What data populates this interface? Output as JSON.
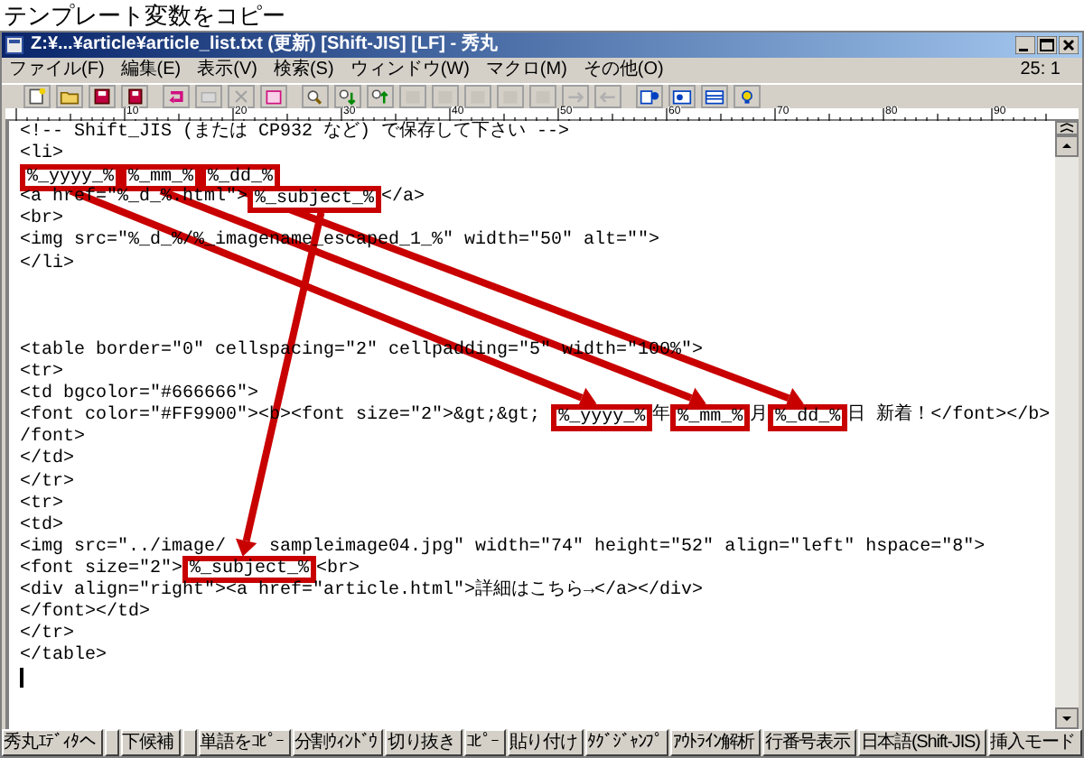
{
  "caption": "テンプレート変数をコピー",
  "window": {
    "title": "Z:¥...¥article¥article_list.txt (更新) [Shift-JIS] [LF] - 秀丸"
  },
  "menu": [
    "ファイル(F)",
    "編集(E)",
    "表示(V)",
    "検索(S)",
    "ウィンドウ(W)",
    "マクロ(M)",
    "その他(O)"
  ],
  "cursor_position": "25: 1",
  "ruler_labels": [
    "10",
    "20",
    "30",
    "40",
    "50",
    "60",
    "70",
    "80",
    "90"
  ],
  "editor": {
    "lines": [
      {
        "kind": "code",
        "segments": [
          {
            "kind": "text",
            "text": "<!-- Shift_JIS (または CP932 など) で保存して下さい -->"
          }
        ]
      },
      {
        "kind": "code",
        "segments": [
          {
            "kind": "text",
            "text": "<li>"
          }
        ]
      },
      {
        "kind": "code",
        "segments": [
          {
            "kind": "variable",
            "text": "%_yyyy_%"
          },
          {
            "kind": "variable",
            "text": "%_mm_%"
          },
          {
            "kind": "variable",
            "text": "%_dd_%"
          }
        ]
      },
      {
        "kind": "code",
        "segments": [
          {
            "kind": "text",
            "text": "<a href=\"%_d_%.html\">"
          },
          {
            "kind": "variable",
            "text": "%_subject_%"
          },
          {
            "kind": "text",
            "text": "</a>"
          }
        ]
      },
      {
        "kind": "code",
        "segments": [
          {
            "kind": "text",
            "text": "<br>"
          }
        ]
      },
      {
        "kind": "code",
        "segments": [
          {
            "kind": "text",
            "text": "<img src=\"%_d_%/%_imagename_escaped_1_%\" width=\"50\" alt=\"\">"
          }
        ]
      },
      {
        "kind": "code",
        "segments": [
          {
            "kind": "text",
            "text": "</li>"
          }
        ]
      },
      {
        "kind": "blank"
      },
      {
        "kind": "blank"
      },
      {
        "kind": "blank"
      },
      {
        "kind": "code",
        "segments": [
          {
            "kind": "text",
            "text": "<table border=\"0\" cellspacing=\"2\" cellpadding=\"5\" width=\"100%\">"
          }
        ]
      },
      {
        "kind": "code",
        "segments": [
          {
            "kind": "text",
            "text": "<tr>"
          }
        ]
      },
      {
        "kind": "code",
        "segments": [
          {
            "kind": "text",
            "text": "<td bgcolor=\"#666666\">"
          }
        ]
      },
      {
        "kind": "code",
        "segments": [
          {
            "kind": "text",
            "text": "<font color=\"#FF9900\"><b><font size=\"2\">&gt;&gt; "
          },
          {
            "kind": "variable",
            "text": "%_yyyy_%"
          },
          {
            "kind": "text",
            "text": "年"
          },
          {
            "kind": "variable",
            "text": "%_mm_%"
          },
          {
            "kind": "text",
            "text": "月"
          },
          {
            "kind": "variable",
            "text": "%_dd_%"
          },
          {
            "kind": "text",
            "text": "日 新着！</font></b>"
          }
        ]
      },
      {
        "kind": "code",
        "segments": [
          {
            "kind": "text",
            "text": "/font>"
          }
        ]
      },
      {
        "kind": "code",
        "segments": [
          {
            "kind": "text",
            "text": "</td>"
          }
        ]
      },
      {
        "kind": "code",
        "segments": [
          {
            "kind": "text",
            "text": "</tr>"
          }
        ]
      },
      {
        "kind": "code",
        "segments": [
          {
            "kind": "text",
            "text": "<tr>"
          }
        ]
      },
      {
        "kind": "code",
        "segments": [
          {
            "kind": "text",
            "text": "<td>"
          }
        ]
      },
      {
        "kind": "code",
        "segments": [
          {
            "kind": "text",
            "text": "<img src=\"../image/    sampleimage04.jpg\" width=\"74\" height=\"52\" align=\"left\" hspace=\"8\">"
          }
        ]
      },
      {
        "kind": "code",
        "segments": [
          {
            "kind": "text",
            "text": "<font size=\"2\">"
          },
          {
            "kind": "variable",
            "text": "%_subject_%"
          },
          {
            "kind": "text",
            "text": "<br>"
          }
        ]
      },
      {
        "kind": "code",
        "segments": [
          {
            "kind": "text",
            "text": "<div align=\"right\"><a href=\"article.html\">詳細はこちら→</a></div>"
          }
        ]
      },
      {
        "kind": "code",
        "segments": [
          {
            "kind": "text",
            "text": "</font></td>"
          }
        ]
      },
      {
        "kind": "code",
        "segments": [
          {
            "kind": "text",
            "text": "</tr>"
          }
        ]
      },
      {
        "kind": "code",
        "segments": [
          {
            "kind": "text",
            "text": "</table>"
          }
        ]
      }
    ]
  },
  "status_bar": [
    {
      "kind": "key",
      "label": "秀丸ｴﾃﾞｨﾀへ"
    },
    {
      "kind": "blank"
    },
    {
      "kind": "key",
      "label": "下候補"
    },
    {
      "kind": "blank"
    },
    {
      "kind": "key",
      "label": "単語をｺﾋﾟｰ"
    },
    {
      "kind": "key",
      "label": "分割ｳｨﾝﾄﾞｳ"
    },
    {
      "kind": "key",
      "label": "切り抜き"
    },
    {
      "kind": "key",
      "label": "ｺﾋﾟｰ"
    },
    {
      "kind": "key",
      "label": "貼り付け"
    },
    {
      "kind": "key",
      "label": "ﾀｸﾞｼﾞｬﾝﾌﾟ"
    },
    {
      "kind": "key",
      "label": "ｱｳﾄﾗｲﾝ解析"
    },
    {
      "kind": "key",
      "label": "行番号表示"
    },
    {
      "kind": "key",
      "label": "日本語(Shift-JIS)"
    },
    {
      "kind": "key",
      "label": "挿入モード"
    }
  ]
}
